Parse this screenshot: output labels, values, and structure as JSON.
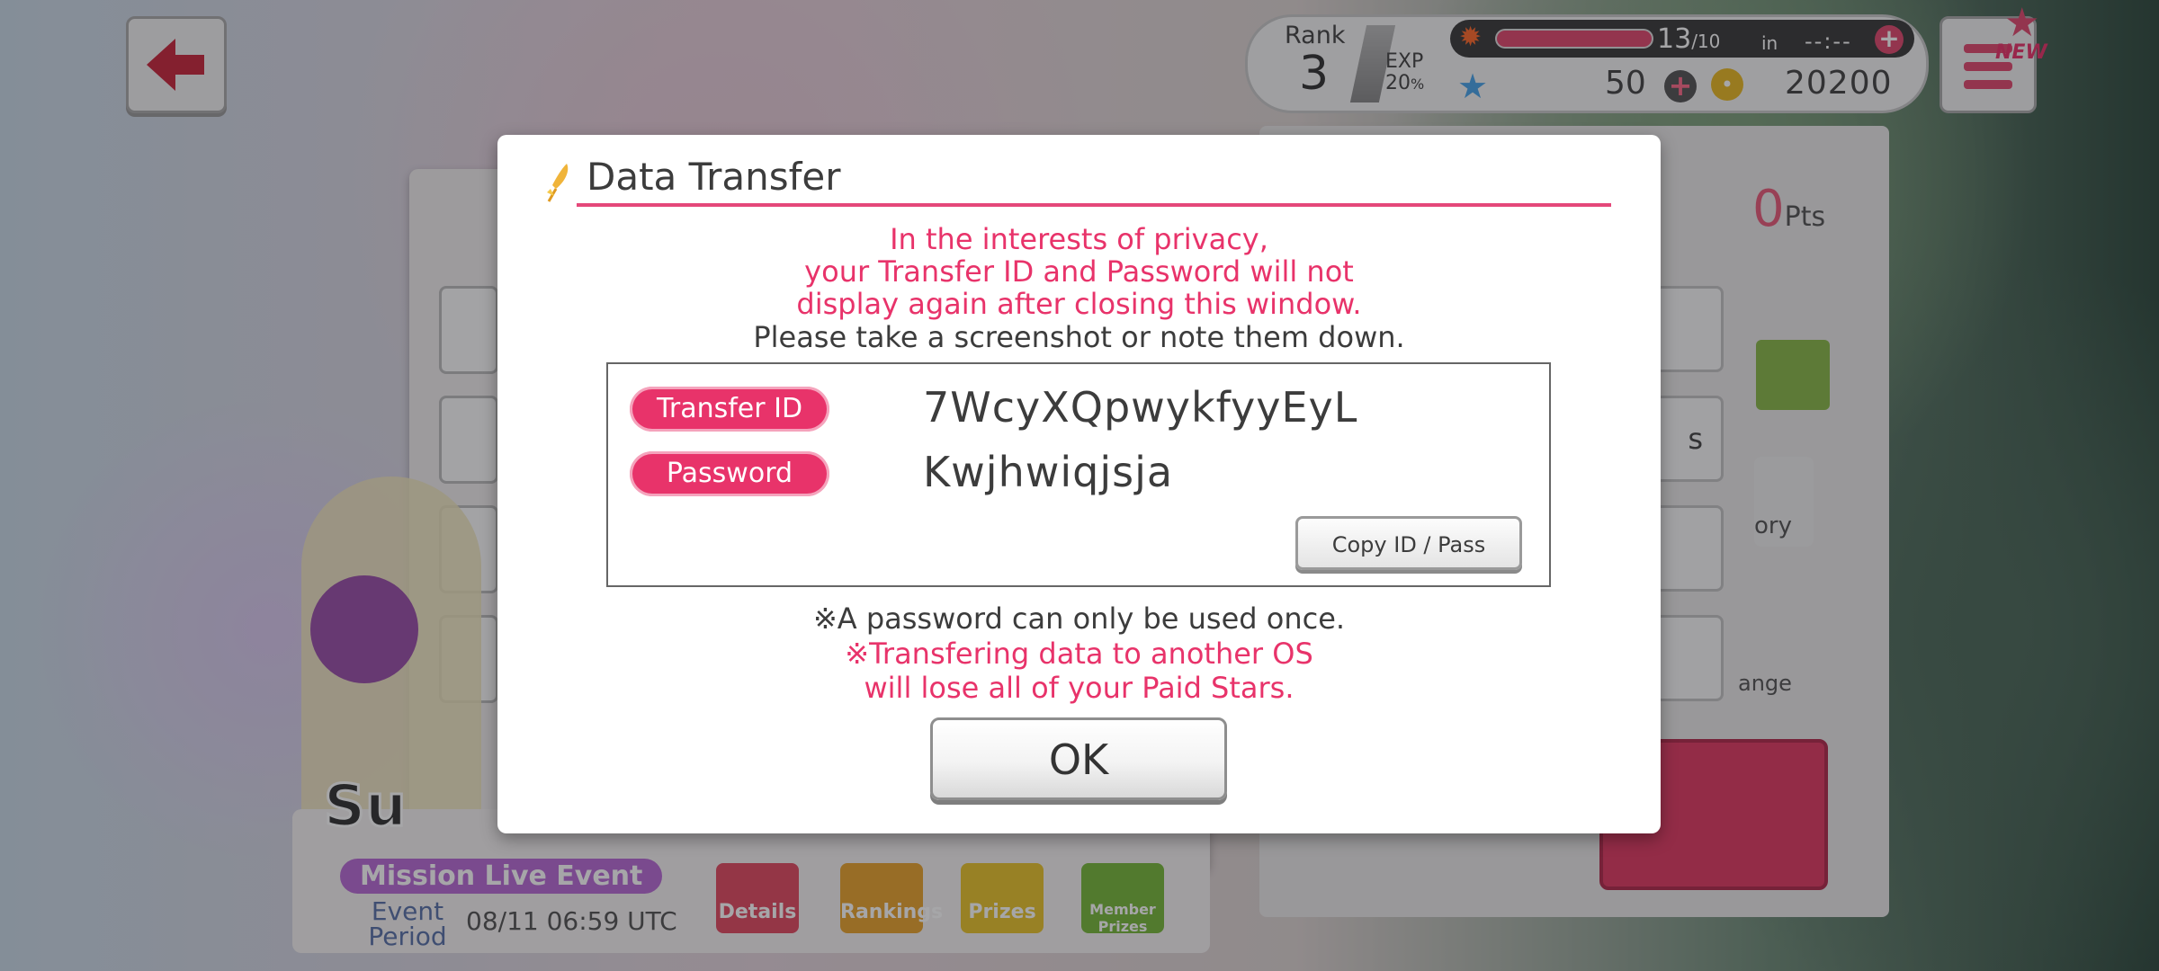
{
  "background": {
    "points_unit": "Pts",
    "points_value": "0",
    "event_badge": "Mission Live Event",
    "event_period_label": "Event Period",
    "event_period_value": "08/11 06:59 UTC",
    "tiles": [
      "Details",
      "Rankings",
      "Prizes",
      "Member Prizes"
    ],
    "tile_colors": [
      "#e24b62",
      "#e9a32e",
      "#e8c32c",
      "#78b83a"
    ],
    "story_label": "ory",
    "exchange_label": "ange",
    "right_label": "s",
    "logo_fragment": "Su"
  },
  "hud": {
    "rank_label": "Rank",
    "rank_value": "3",
    "exp_label": "EXP",
    "exp_value": "20",
    "exp_unit": "%",
    "stamina_current": "13",
    "stamina_max": "/10",
    "stamina_in": "in",
    "stamina_time": "--:--",
    "stamina_plus": "+",
    "stamina_fill": 1.0,
    "stars_value": "50",
    "stars_plus": "+",
    "coin_value": "20200",
    "menu_badge": "NEW",
    "icons": [
      "back-arrow-icon",
      "flame-icon",
      "star-icon",
      "coin-icon",
      "menu-icon"
    ]
  },
  "modal": {
    "title": "Data Transfer",
    "privacy_line1": "In the interests of privacy,",
    "privacy_line2": "your Transfer ID and Password will not",
    "privacy_line3": "display again after closing this window.",
    "screenshot_note": "Please take a screenshot or note them down.",
    "transfer_id_label": "Transfer ID",
    "transfer_id_value": "7WcyXQpwykfyyEyL",
    "password_label": "Password",
    "password_value": "Kwjhwiqjsja",
    "copy_button": "Copy ID / Pass",
    "note_once": "※A password can only be used once.",
    "warn_line1": "※Transfering data to another OS",
    "warn_line2": "will lose all of your Paid Stars.",
    "ok_button": "OK",
    "accent_color": "#e8336a"
  }
}
